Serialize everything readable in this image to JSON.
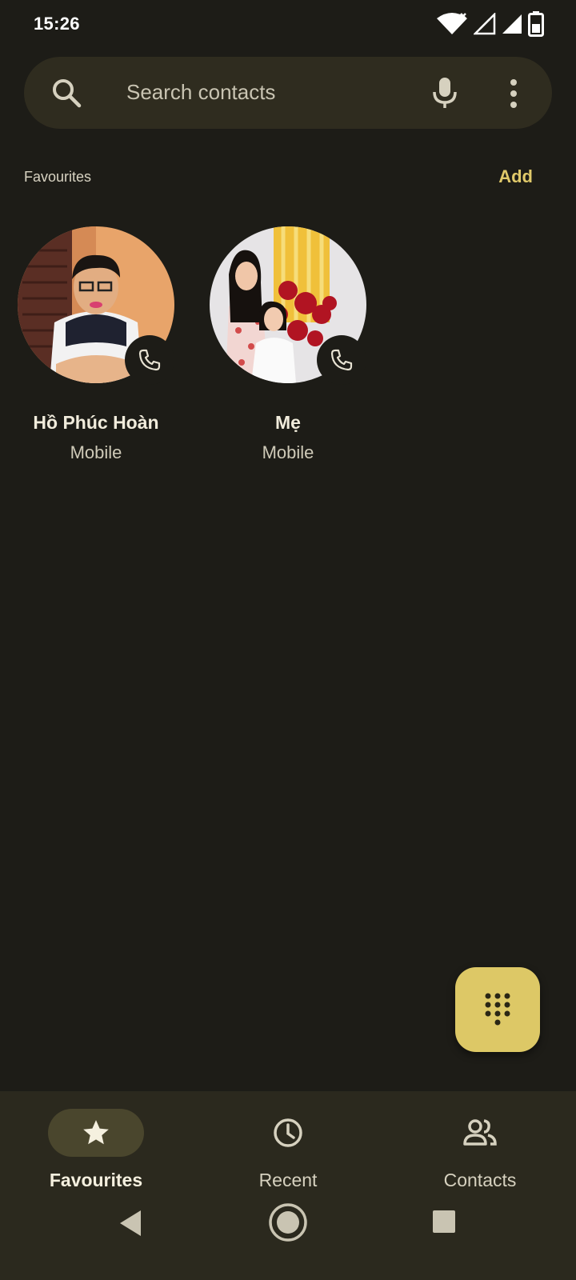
{
  "status_bar": {
    "time": "15:26",
    "icons": [
      "wifi-icon",
      "signal-no-data-icon",
      "signal-icon",
      "battery-icon"
    ]
  },
  "search": {
    "placeholder": "Search contacts",
    "icons": [
      "search-icon",
      "mic-icon",
      "more-vert-icon"
    ]
  },
  "favourites": {
    "title": "Favourites",
    "add_label": "Add",
    "contacts": [
      {
        "name": "Hồ Phúc Hoàn",
        "type": "Mobile"
      },
      {
        "name": "Mẹ",
        "type": "Mobile"
      }
    ]
  },
  "fab": {
    "icon": "dialpad-icon"
  },
  "bottom_nav": {
    "items": [
      {
        "label": "Favourites",
        "icon": "star-icon",
        "active": true
      },
      {
        "label": "Recent",
        "icon": "clock-icon",
        "active": false
      },
      {
        "label": "Contacts",
        "icon": "people-icon",
        "active": false
      }
    ]
  },
  "system_nav": [
    "back-icon",
    "home-icon",
    "recents-icon"
  ],
  "colors": {
    "background": "#1d1c17",
    "accent": "#ddc866",
    "search_bg": "#2f2c1f",
    "nav_bg": "#2b291e"
  }
}
